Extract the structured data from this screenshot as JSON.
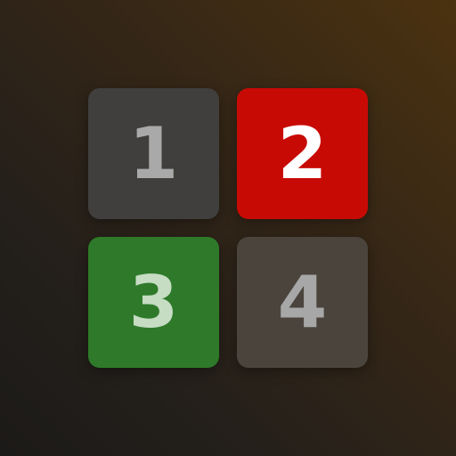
{
  "tiles": [
    {
      "label": "1",
      "background": "#403f3d",
      "color": "#a9a9a9"
    },
    {
      "label": "2",
      "background": "#c80a05",
      "color": "#ffffff"
    },
    {
      "label": "3",
      "background": "#2e7a2a",
      "color": "#c6dcc3"
    },
    {
      "label": "4",
      "background": "#4a443d",
      "color": "#a7a7a7"
    }
  ]
}
